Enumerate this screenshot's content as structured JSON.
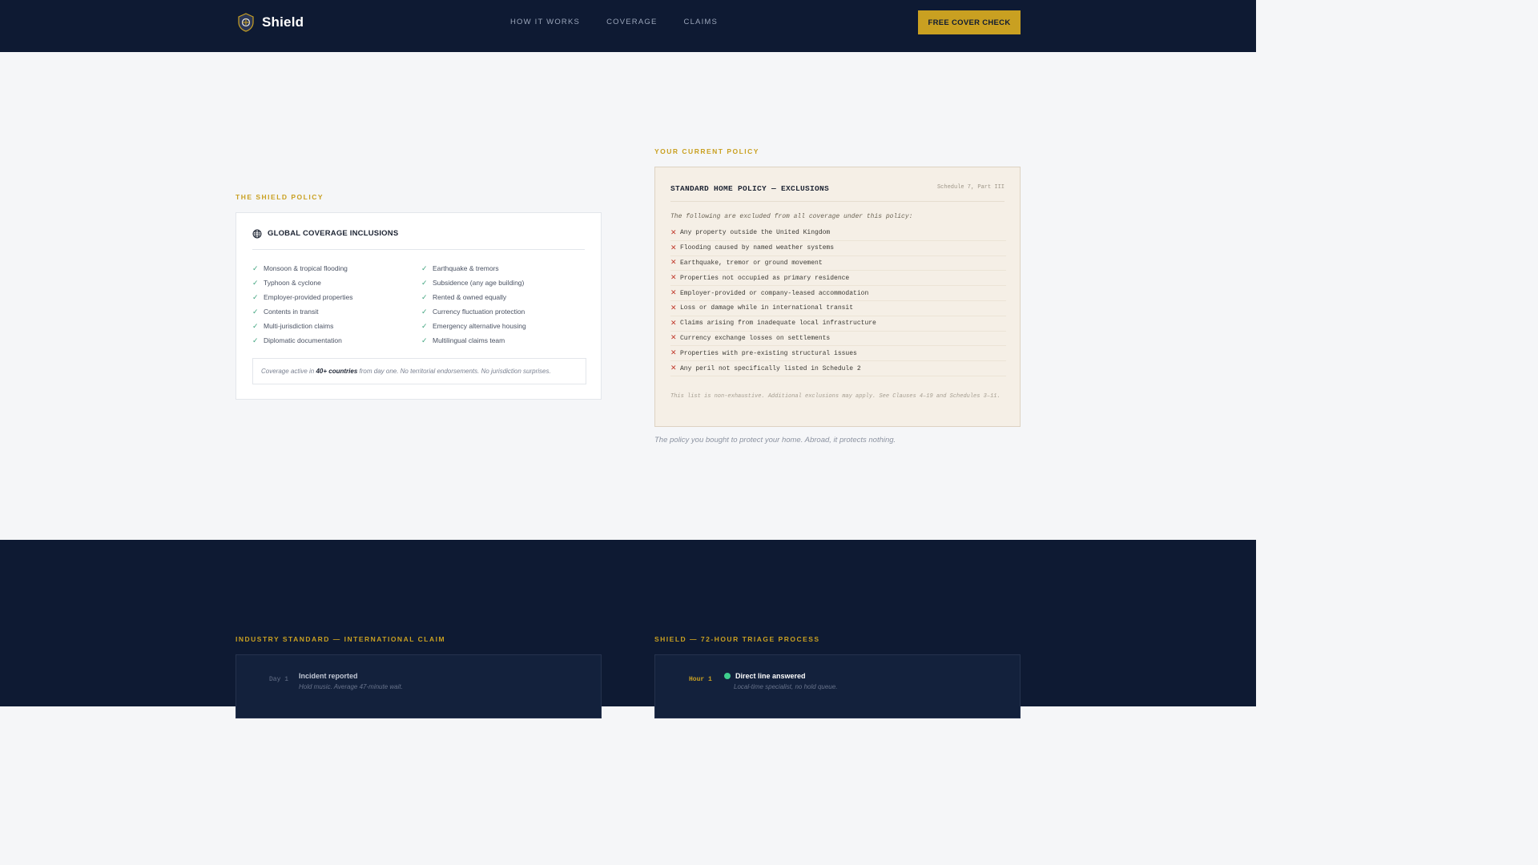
{
  "header": {
    "brand": "Shield",
    "nav": [
      "HOW IT WORKS",
      "COVERAGE",
      "CLAIMS"
    ],
    "cta": "FREE COVER CHECK"
  },
  "shield_policy": {
    "eyebrow": "THE SHIELD POLICY",
    "title": "GLOBAL COVERAGE INCLUSIONS",
    "icon": "globe-icon",
    "inclusions": [
      "Monsoon & tropical flooding",
      "Earthquake & tremors",
      "Typhoon & cyclone",
      "Subsidence (any age building)",
      "Employer-provided properties",
      "Rented & owned equally",
      "Contents in transit",
      "Currency fluctuation protection",
      "Multi-jurisdiction claims",
      "Emergency alternative housing",
      "Diplomatic documentation",
      "Multilingual claims team"
    ],
    "note_pre": "Coverage active in ",
    "note_bold": "40+ countries",
    "note_post": " from day one. No territorial endorsements. No jurisdiction surprises."
  },
  "current_policy": {
    "eyebrow": "YOUR CURRENT POLICY",
    "title": "STANDARD HOME POLICY — EXCLUSIONS",
    "schedule": "Schedule 7, Part III",
    "intro": "The following are excluded from all coverage under this policy:",
    "exclusions": [
      "Any property outside the United Kingdom",
      "Flooding caused by named weather systems",
      "Earthquake, tremor or ground movement",
      "Properties not occupied as primary residence",
      "Employer-provided or company-leased accommodation",
      "Loss or damage while in international transit",
      "Claims arising from inadequate local infrastructure",
      "Currency exchange losses on settlements",
      "Properties with pre-existing structural issues",
      "Any peril not specifically listed in Schedule 2"
    ],
    "footnote": "This list is non-exhaustive. Additional exclusions may apply. See Clauses 4–19 and Schedules 3–11.",
    "caption": "The policy you bought to protect your home. Abroad, it protects nothing."
  },
  "industry": {
    "eyebrow": "INDUSTRY STANDARD — INTERNATIONAL CLAIM",
    "steps": [
      {
        "time": "Day 1",
        "title": "Incident reported",
        "sub": "Hold music. Average 47-minute wait."
      }
    ]
  },
  "shield_triage": {
    "eyebrow": "SHIELD — 72-HOUR TRIAGE PROCESS",
    "steps": [
      {
        "time": "Hour 1",
        "title": "Direct line answered",
        "sub": "Local-time specialist, no hold queue."
      }
    ]
  },
  "colors": {
    "navy": "#0e1a33",
    "gold": "#c9a021",
    "check_green": "#3fa37d",
    "cross_red": "#c0392b",
    "dot_green": "#3ecf8e"
  }
}
